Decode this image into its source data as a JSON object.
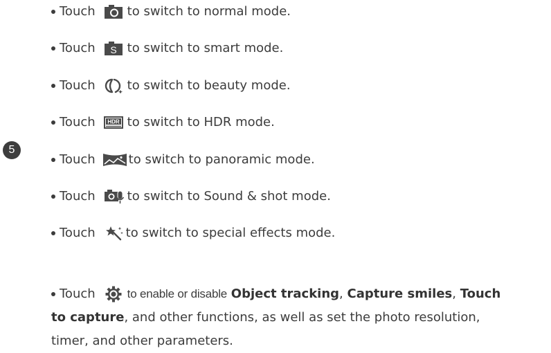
{
  "step_number": "5",
  "items": [
    {
      "touch": "Touch",
      "text": "to switch to normal mode.",
      "icon": "camera-icon"
    },
    {
      "touch": "Touch",
      "text": "to switch to smart mode.",
      "icon": "smart-mode-icon"
    },
    {
      "touch": "Touch",
      "text": "to switch to beauty mode.",
      "icon": "beauty-icon"
    },
    {
      "touch": "Touch",
      "text": "to switch to HDR mode.",
      "icon": "hdr-icon",
      "icon_label": "HDR"
    },
    {
      "touch": "Touch",
      "text": "to switch to panoramic mode.",
      "icon": "panorama-icon"
    },
    {
      "touch": "Touch",
      "text": "to switch to Sound & shot mode.",
      "icon": "sound-shot-icon"
    },
    {
      "touch": "Touch",
      "text": "to switch to special effects mode.",
      "icon": "magic-wand-icon"
    }
  ],
  "settings_item": {
    "touch": "Touch",
    "icon": "gear-icon",
    "part1": "to enable or disable",
    "bold1": "Object tracking",
    "sep1": ",",
    "bold2": "Capture smiles",
    "sep2": ",",
    "bold3a": "Touch",
    "bold3b": "to capture",
    "line2_rest": ", and other functions, as well as set the photo resolution,",
    "line3": "timer, and other parameters."
  },
  "colors": {
    "text": "#3c3c3c",
    "icon": "#4a4a4a",
    "badge": "#3d3d3d"
  }
}
